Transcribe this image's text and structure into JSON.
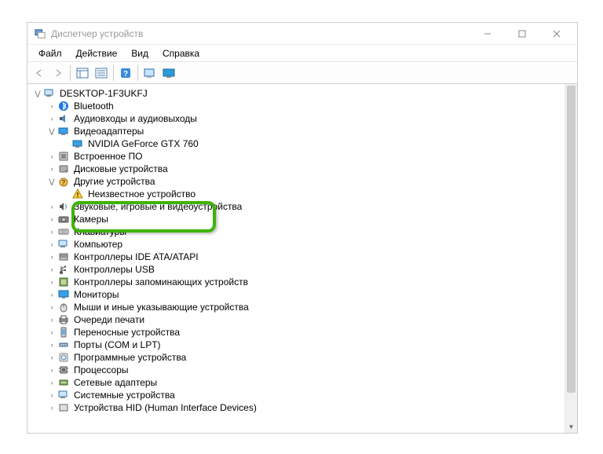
{
  "window": {
    "title": "Диспетчер устройств"
  },
  "menu": {
    "file": "Файл",
    "action": "Действие",
    "view": "Вид",
    "help": "Справка"
  },
  "tree": {
    "root": "DESKTOP-1F3UKFJ",
    "bluetooth": "Bluetooth",
    "audio_io": "Аудиовходы и аудиовыходы",
    "video_adapters": "Видеоадаптеры",
    "gpu": "NVIDIA GeForce GTX 760",
    "embedded": "Встроенное ПО",
    "disk": "Дисковые устройства",
    "other": "Другие устройства",
    "unknown": "Неизвестное устройство",
    "sound": "Звуковые, игровые и видеоустройства",
    "cameras": "Камеры",
    "keyboards": "Клавиатуры",
    "computer": "Компьютер",
    "ide": "Контроллеры IDE ATA/ATAPI",
    "usb": "Контроллеры USB",
    "storage_ctrl": "Контроллеры запоминающих устройств",
    "monitors": "Мониторы",
    "mice": "Мыши и иные указывающие устройства",
    "print_queues": "Очереди печати",
    "portable": "Переносные устройства",
    "ports": "Порты (COM и LPT)",
    "software": "Программные устройства",
    "processors": "Процессоры",
    "network": "Сетевые адаптеры",
    "system": "Системные устройства",
    "hid": "Устройства HID (Human Interface Devices)"
  }
}
